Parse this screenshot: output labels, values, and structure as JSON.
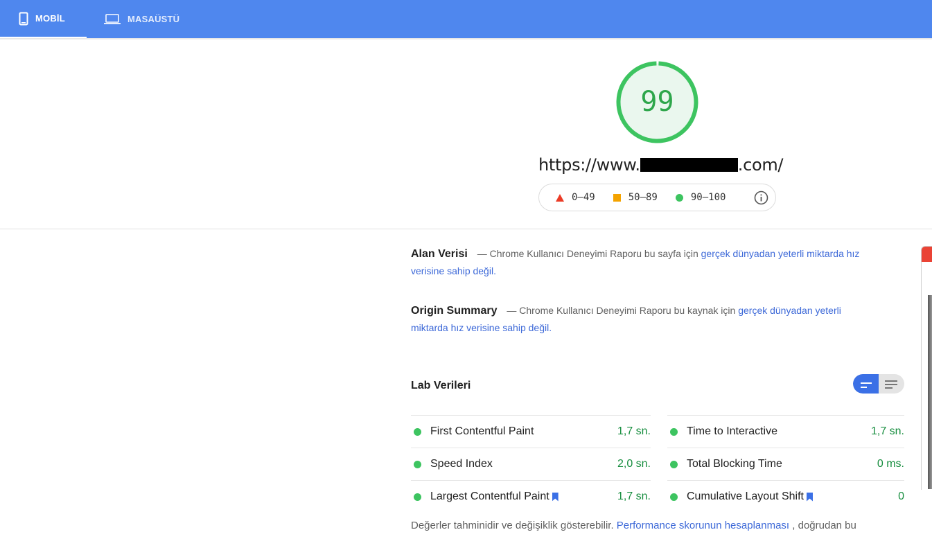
{
  "tabs": [
    {
      "label": "MOBİL",
      "icon": "phone-icon",
      "active": true
    },
    {
      "label": "MASAÜSTÜ",
      "icon": "laptop-icon",
      "active": false
    }
  ],
  "score": {
    "value": "99",
    "color": "#3dc460"
  },
  "url": {
    "prefix": "https://www.",
    "suffix": ".com/"
  },
  "legend": [
    {
      "range": "0–49",
      "icon": "triangle-icon",
      "color": "#eb3b26"
    },
    {
      "range": "50–89",
      "icon": "square-icon",
      "color": "#f4a300"
    },
    {
      "range": "90–100",
      "icon": "circle-icon",
      "color": "#3dc460"
    }
  ],
  "field_data": {
    "title": "Alan Verisi",
    "dash": "—",
    "text": "Chrome Kullanıcı Deneyimi Raporu bu sayfa için",
    "link": "gerçek dünyadan yeterli miktarda hız verisine sahip değil."
  },
  "origin_summary": {
    "title": "Origin Summary",
    "dash": "—",
    "text": "Chrome Kullanıcı Deneyimi Raporu bu kaynak için",
    "link": "gerçek dünyadan yeterli miktarda hız verisine sahip değil."
  },
  "lab": {
    "title": "Lab Verileri",
    "metrics_left": [
      {
        "name": "First Contentful Paint",
        "value": "1,7 sn.",
        "bookmark": false
      },
      {
        "name": "Speed Index",
        "value": "2,0 sn.",
        "bookmark": false
      },
      {
        "name": "Largest Contentful Paint",
        "value": "1,7 sn.",
        "bookmark": true
      }
    ],
    "metrics_right": [
      {
        "name": "Time to Interactive",
        "value": "1,7 sn.",
        "bookmark": false
      },
      {
        "name": "Total Blocking Time",
        "value": "0 ms.",
        "bookmark": false
      },
      {
        "name": "Cumulative Layout Shift",
        "value": "0",
        "bookmark": true
      }
    ]
  },
  "note": {
    "text": "Değerler tahminidir ve değişiklik gösterebilir.",
    "link": "Performance skorunun hesaplanması",
    "tail": ", doğrudan bu"
  }
}
